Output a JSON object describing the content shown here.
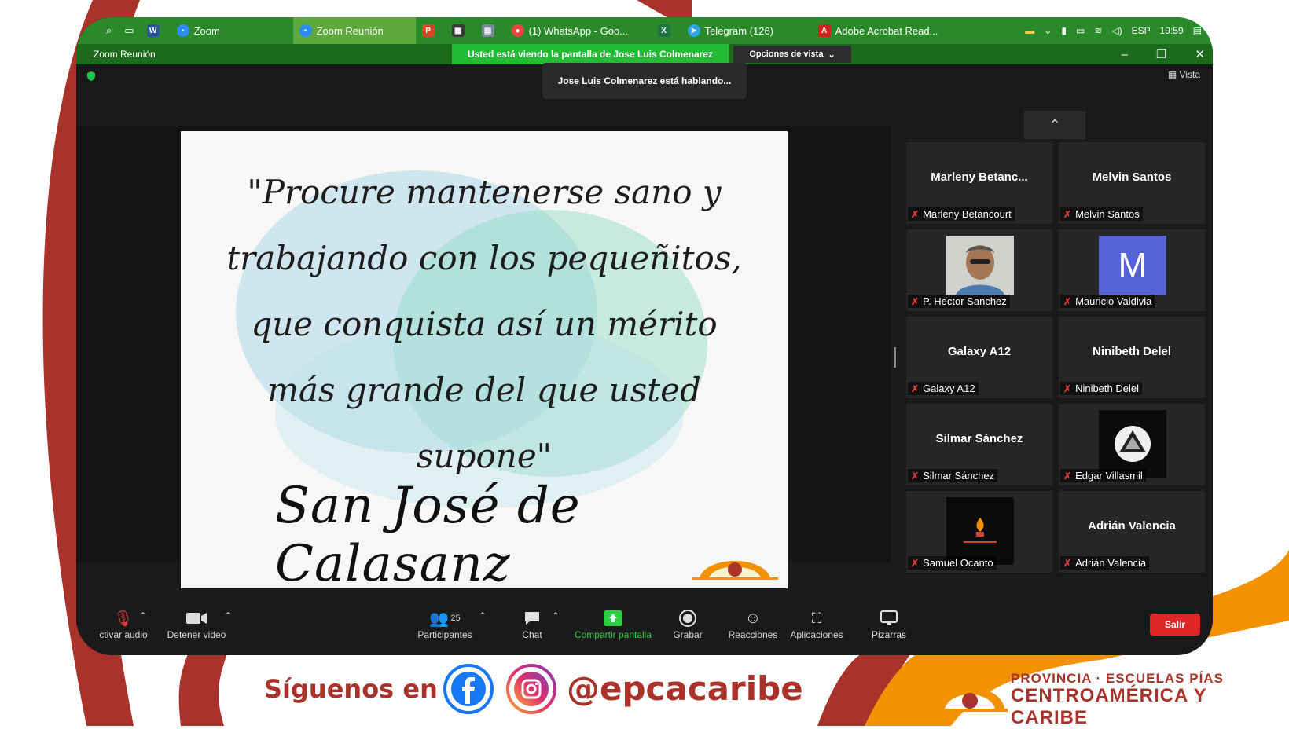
{
  "taskbar": {
    "items": [
      {
        "label": "Zoom",
        "icon": "zoom-icon"
      },
      {
        "label": "Zoom Reunión",
        "icon": "zoom-icon"
      },
      {
        "label": "(1) WhatsApp - Goo...",
        "icon": "chrome-icon"
      },
      {
        "label": "Telegram (126)",
        "icon": "telegram-icon"
      },
      {
        "label": "Adobe Acrobat Read...",
        "icon": "acrobat-icon"
      }
    ],
    "lang": "ESP",
    "time": "19:59"
  },
  "window": {
    "title": "Zoom Reunión",
    "viewing_banner": "Usted está viendo la pantalla de Jose Luis Colmenarez",
    "view_options": "Opciones de vista",
    "speaking": "Jose Luis Colmenarez está hablando...",
    "vista_label": "Vista"
  },
  "slide": {
    "quote_lines": [
      "\"Procure mantenerse sano y",
      "trabajando con los pequeñitos,",
      "que conquista así un mérito",
      "más grande del que usted",
      "supone\""
    ],
    "signature": "San José de Calasanz"
  },
  "gallery": {
    "tiles": [
      {
        "display_name": "Marleny  Betanc...",
        "label": "Marleny Betancourt"
      },
      {
        "display_name": "Melvin Santos",
        "label": "Melvin Santos"
      },
      {
        "display_name": "",
        "label": "P. Hector Sanchez",
        "avatar": "photo"
      },
      {
        "display_name": "",
        "label": "Mauricio Valdivia",
        "avatar": "M"
      },
      {
        "display_name": "Galaxy A12",
        "label": "Galaxy A12"
      },
      {
        "display_name": "Ninibeth Delel",
        "label": "Ninibeth Delel"
      },
      {
        "display_name": "Silmar Sánchez",
        "label": "Silmar Sánchez"
      },
      {
        "display_name": "",
        "label": "Edgar Villasmil",
        "avatar": "logo"
      },
      {
        "display_name": "",
        "label": "Samuel Ocanto",
        "avatar": "dark"
      },
      {
        "display_name": "Adrián Valencia",
        "label": "Adrián Valencia"
      }
    ]
  },
  "toolbar": {
    "audio_label": "ctivar audio",
    "video_label": "Detener video",
    "participants_label": "Participantes",
    "participants_count": "25",
    "chat_label": "Chat",
    "share_label": "Compartir pantalla",
    "record_label": "Grabar",
    "reactions_label": "Reacciones",
    "apps_label": "Aplicaciones",
    "whiteboards_label": "Pizarras",
    "leave_label": "Salir"
  },
  "footer": {
    "follow_text": "Síguenos en",
    "handle": "@epcacaribe",
    "province_line1": "PROVINCIA · ESCUELAS PÍAS",
    "province_line2": "CENTROAMÉRICA Y CARIBE"
  },
  "colors": {
    "brand_red": "#a9322a",
    "brand_orange": "#f39200",
    "zoom_green": "#22bb33",
    "leave_red": "#e02727"
  }
}
